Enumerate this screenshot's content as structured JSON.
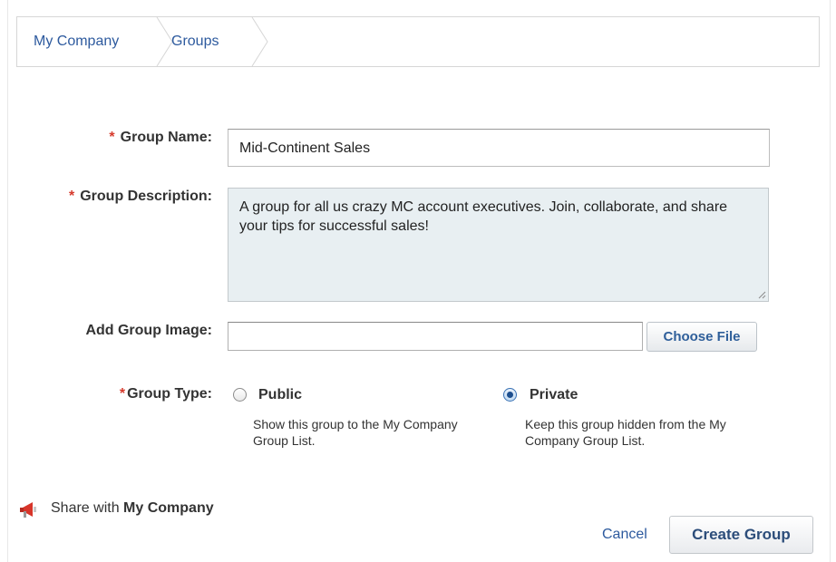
{
  "breadcrumb": {
    "items": [
      "My Company",
      "Groups"
    ]
  },
  "form": {
    "required_mark": "*",
    "group_name": {
      "label": "Group Name:",
      "value": "Mid-Continent Sales"
    },
    "group_description": {
      "label": "Group Description:",
      "value": "A group for all us crazy MC account executives. Join, collaborate, and share your tips for successful sales!"
    },
    "group_image": {
      "label": "Add Group Image:",
      "button": "Choose File"
    },
    "group_type": {
      "label": "Group Type:",
      "selected": "Private",
      "options": [
        {
          "label": "Public",
          "description": "Show this group to the My Company Group List."
        },
        {
          "label": "Private",
          "description": "Keep this group hidden from the My Company Group List."
        }
      ]
    }
  },
  "share": {
    "prefix": "Share with",
    "target": "My Company",
    "icon": "megaphone-icon"
  },
  "actions": {
    "cancel": "Cancel",
    "create": "Create Group"
  },
  "colors": {
    "link": "#2d5a9e",
    "required": "#d63a2c",
    "textarea_bg": "#e8eff2"
  }
}
